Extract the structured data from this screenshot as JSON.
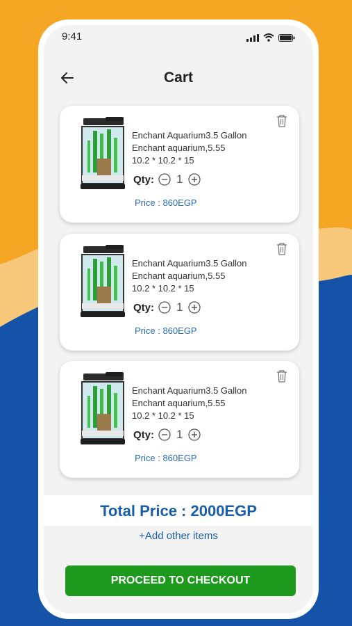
{
  "status_bar": {
    "time": "9:41"
  },
  "header": {
    "title": "Cart"
  },
  "cart": {
    "items": [
      {
        "name_line1": "Enchant Aquarium3.5 Gallon",
        "name_line2": "Enchant aquarium,5.55",
        "dimensions": "10.2 * 10.2 * 15",
        "qty_label": "Qty:",
        "qty": "1",
        "price": "Price : 860EGP"
      },
      {
        "name_line1": "Enchant Aquarium3.5 Gallon",
        "name_line2": "Enchant aquarium,5.55",
        "dimensions": "10.2 * 10.2 * 15",
        "qty_label": "Qty:",
        "qty": "1",
        "price": "Price : 860EGP"
      },
      {
        "name_line1": "Enchant Aquarium3.5 Gallon",
        "name_line2": "Enchant aquarium,5.55",
        "dimensions": "10.2 * 10.2 * 15",
        "qty_label": "Qty:",
        "qty": "1",
        "price": "Price : 860EGP"
      }
    ]
  },
  "summary": {
    "total": "Total Price : 2000EGP",
    "add_items": "+Add other items",
    "checkout": "PROCEED TO CHECKOUT"
  },
  "colors": {
    "background_orange": "#f5a623",
    "background_blue": "#1553a8",
    "accent_blue": "#1a5ea8",
    "checkout_green": "#1d9a1d"
  },
  "icons": [
    "back-arrow-icon",
    "trash-icon",
    "minus-circle-icon",
    "plus-circle-icon",
    "signal-icon",
    "wifi-icon",
    "battery-icon"
  ]
}
